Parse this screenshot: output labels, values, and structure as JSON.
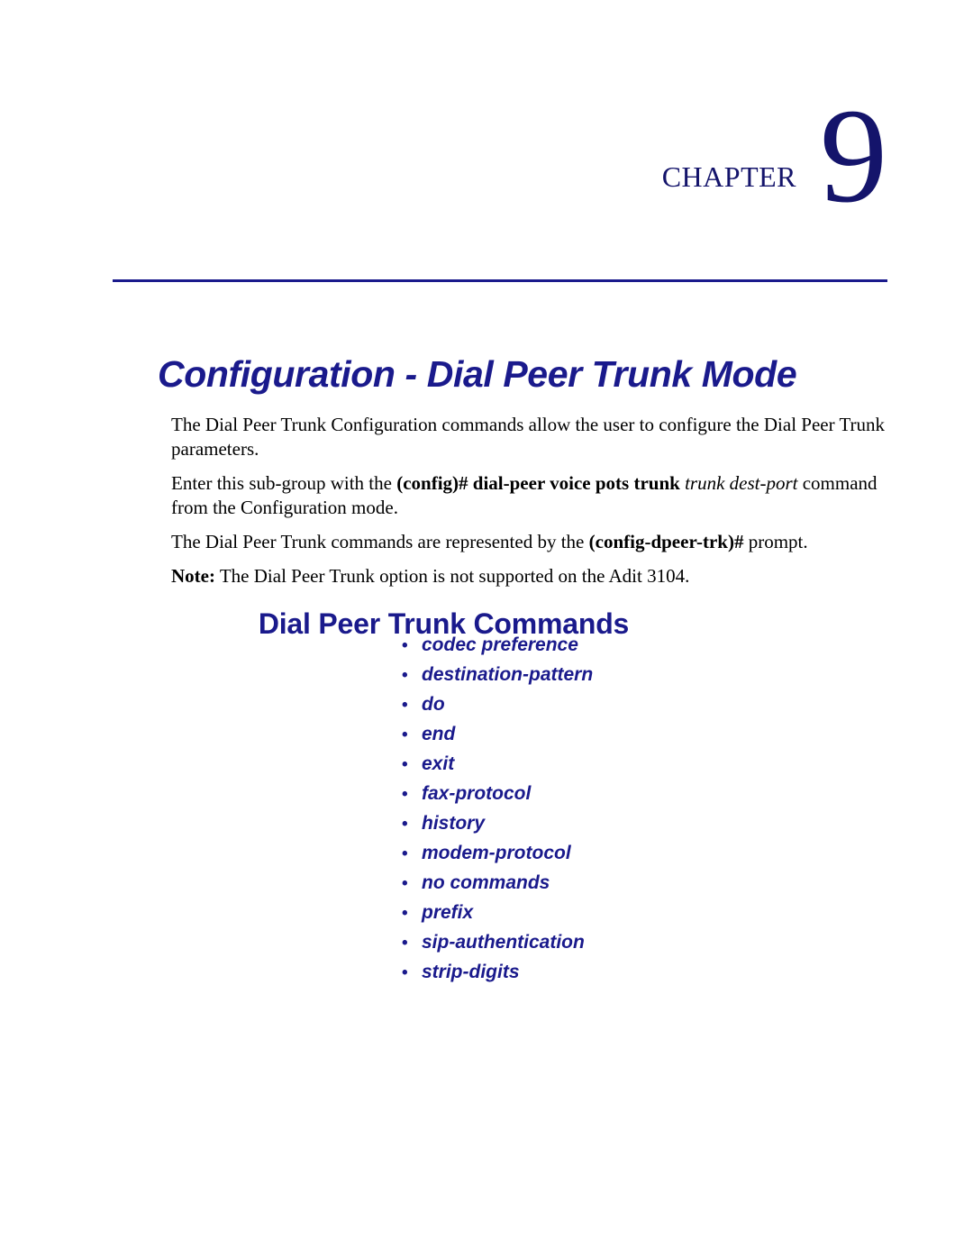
{
  "header": {
    "chapter_word": "Chapter",
    "chapter_number": "9"
  },
  "title": "Configuration - Dial Peer Trunk Mode",
  "body": {
    "p1": {
      "text": "The Dial Peer Trunk Configuration commands allow the user to configure the Dial Peer Trunk parameters."
    },
    "p2": {
      "lead": "Enter this sub-group with the ",
      "bold": "(config)# dial-peer voice pots trunk",
      "italic": " trunk dest-port",
      "tail": " command from the Configuration mode."
    },
    "p3": {
      "lead": "The Dial Peer Trunk commands are represented by the ",
      "bold": "(config-dpeer-trk)#",
      "tail": " prompt."
    },
    "p4": {
      "bold": "Note:",
      "tail": " The Dial Peer Trunk option is not supported on the Adit 3104."
    }
  },
  "sub_heading": "Dial Peer Trunk Commands",
  "commands": [
    {
      "bullet": "•",
      "label": "codec preference"
    },
    {
      "bullet": "•",
      "label": "destination-pattern"
    },
    {
      "bullet": "•",
      "label": "do"
    },
    {
      "bullet": "•",
      "label": "end"
    },
    {
      "bullet": "•",
      "label": "exit"
    },
    {
      "bullet": "•",
      "label": "fax-protocol"
    },
    {
      "bullet": "•",
      "label": "history"
    },
    {
      "bullet": "•",
      "label": "modem-protocol"
    },
    {
      "bullet": "•",
      "label": "no commands"
    },
    {
      "bullet": "•",
      "label": "prefix"
    },
    {
      "bullet": "•",
      "label": "sip-authentication"
    },
    {
      "bullet": "•",
      "label": "strip-digits"
    }
  ],
  "colors": {
    "navy": "#14146b",
    "title_blue": "#1a1a8c",
    "body_text": "#000000",
    "page_background": "#ffffff"
  }
}
